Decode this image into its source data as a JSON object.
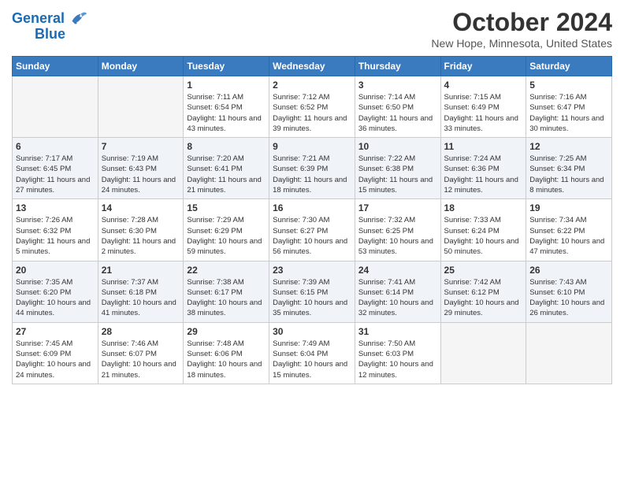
{
  "header": {
    "logo_line1": "General",
    "logo_line2": "Blue",
    "title": "October 2024",
    "subtitle": "New Hope, Minnesota, United States"
  },
  "days_of_week": [
    "Sunday",
    "Monday",
    "Tuesday",
    "Wednesday",
    "Thursday",
    "Friday",
    "Saturday"
  ],
  "weeks": [
    [
      {
        "num": "",
        "info": ""
      },
      {
        "num": "",
        "info": ""
      },
      {
        "num": "1",
        "info": "Sunrise: 7:11 AM\nSunset: 6:54 PM\nDaylight: 11 hours and 43 minutes."
      },
      {
        "num": "2",
        "info": "Sunrise: 7:12 AM\nSunset: 6:52 PM\nDaylight: 11 hours and 39 minutes."
      },
      {
        "num": "3",
        "info": "Sunrise: 7:14 AM\nSunset: 6:50 PM\nDaylight: 11 hours and 36 minutes."
      },
      {
        "num": "4",
        "info": "Sunrise: 7:15 AM\nSunset: 6:49 PM\nDaylight: 11 hours and 33 minutes."
      },
      {
        "num": "5",
        "info": "Sunrise: 7:16 AM\nSunset: 6:47 PM\nDaylight: 11 hours and 30 minutes."
      }
    ],
    [
      {
        "num": "6",
        "info": "Sunrise: 7:17 AM\nSunset: 6:45 PM\nDaylight: 11 hours and 27 minutes."
      },
      {
        "num": "7",
        "info": "Sunrise: 7:19 AM\nSunset: 6:43 PM\nDaylight: 11 hours and 24 minutes."
      },
      {
        "num": "8",
        "info": "Sunrise: 7:20 AM\nSunset: 6:41 PM\nDaylight: 11 hours and 21 minutes."
      },
      {
        "num": "9",
        "info": "Sunrise: 7:21 AM\nSunset: 6:39 PM\nDaylight: 11 hours and 18 minutes."
      },
      {
        "num": "10",
        "info": "Sunrise: 7:22 AM\nSunset: 6:38 PM\nDaylight: 11 hours and 15 minutes."
      },
      {
        "num": "11",
        "info": "Sunrise: 7:24 AM\nSunset: 6:36 PM\nDaylight: 11 hours and 12 minutes."
      },
      {
        "num": "12",
        "info": "Sunrise: 7:25 AM\nSunset: 6:34 PM\nDaylight: 11 hours and 8 minutes."
      }
    ],
    [
      {
        "num": "13",
        "info": "Sunrise: 7:26 AM\nSunset: 6:32 PM\nDaylight: 11 hours and 5 minutes."
      },
      {
        "num": "14",
        "info": "Sunrise: 7:28 AM\nSunset: 6:30 PM\nDaylight: 11 hours and 2 minutes."
      },
      {
        "num": "15",
        "info": "Sunrise: 7:29 AM\nSunset: 6:29 PM\nDaylight: 10 hours and 59 minutes."
      },
      {
        "num": "16",
        "info": "Sunrise: 7:30 AM\nSunset: 6:27 PM\nDaylight: 10 hours and 56 minutes."
      },
      {
        "num": "17",
        "info": "Sunrise: 7:32 AM\nSunset: 6:25 PM\nDaylight: 10 hours and 53 minutes."
      },
      {
        "num": "18",
        "info": "Sunrise: 7:33 AM\nSunset: 6:24 PM\nDaylight: 10 hours and 50 minutes."
      },
      {
        "num": "19",
        "info": "Sunrise: 7:34 AM\nSunset: 6:22 PM\nDaylight: 10 hours and 47 minutes."
      }
    ],
    [
      {
        "num": "20",
        "info": "Sunrise: 7:35 AM\nSunset: 6:20 PM\nDaylight: 10 hours and 44 minutes."
      },
      {
        "num": "21",
        "info": "Sunrise: 7:37 AM\nSunset: 6:18 PM\nDaylight: 10 hours and 41 minutes."
      },
      {
        "num": "22",
        "info": "Sunrise: 7:38 AM\nSunset: 6:17 PM\nDaylight: 10 hours and 38 minutes."
      },
      {
        "num": "23",
        "info": "Sunrise: 7:39 AM\nSunset: 6:15 PM\nDaylight: 10 hours and 35 minutes."
      },
      {
        "num": "24",
        "info": "Sunrise: 7:41 AM\nSunset: 6:14 PM\nDaylight: 10 hours and 32 minutes."
      },
      {
        "num": "25",
        "info": "Sunrise: 7:42 AM\nSunset: 6:12 PM\nDaylight: 10 hours and 29 minutes."
      },
      {
        "num": "26",
        "info": "Sunrise: 7:43 AM\nSunset: 6:10 PM\nDaylight: 10 hours and 26 minutes."
      }
    ],
    [
      {
        "num": "27",
        "info": "Sunrise: 7:45 AM\nSunset: 6:09 PM\nDaylight: 10 hours and 24 minutes."
      },
      {
        "num": "28",
        "info": "Sunrise: 7:46 AM\nSunset: 6:07 PM\nDaylight: 10 hours and 21 minutes."
      },
      {
        "num": "29",
        "info": "Sunrise: 7:48 AM\nSunset: 6:06 PM\nDaylight: 10 hours and 18 minutes."
      },
      {
        "num": "30",
        "info": "Sunrise: 7:49 AM\nSunset: 6:04 PM\nDaylight: 10 hours and 15 minutes."
      },
      {
        "num": "31",
        "info": "Sunrise: 7:50 AM\nSunset: 6:03 PM\nDaylight: 10 hours and 12 minutes."
      },
      {
        "num": "",
        "info": ""
      },
      {
        "num": "",
        "info": ""
      }
    ]
  ]
}
